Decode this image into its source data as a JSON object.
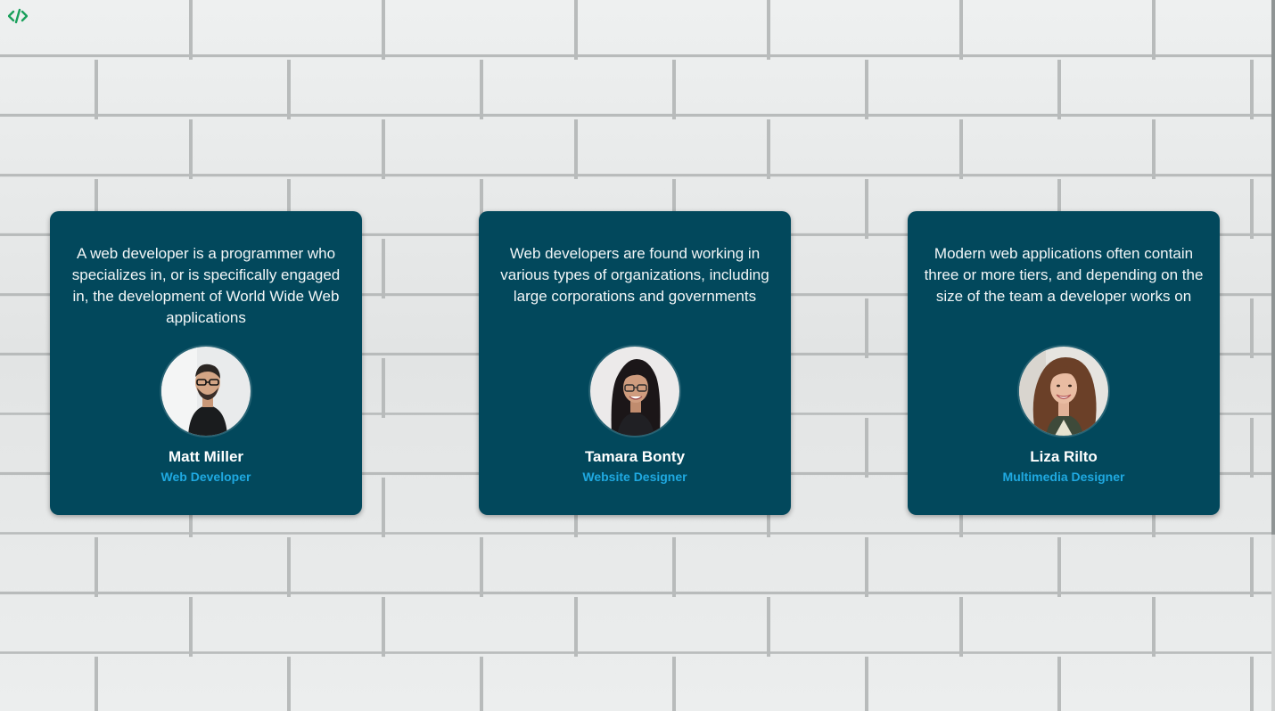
{
  "header": {
    "logo_icon": "code-brackets-icon",
    "logo_color": "#19a05b"
  },
  "colors": {
    "card_background": "#02485c",
    "role_text": "#1fa9e1",
    "name_text": "#ffffff"
  },
  "testimonials": [
    {
      "quote": "A web developer is a programmer who specializes in, or is specifically engaged in, the development of World Wide Web applications",
      "name": "Matt Miller",
      "role": "Web Developer",
      "avatar": "man-with-glasses-avatar"
    },
    {
      "quote": "Web developers are found working in various types of organizations, including large corporations and governments",
      "name": "Tamara Bonty",
      "role": "Website Designer",
      "avatar": "woman-with-glasses-avatar"
    },
    {
      "quote": "Modern web applications often contain three or more tiers, and depending on the size of the team a developer works on",
      "name": "Liza Rilto",
      "role": "Multimedia Designer",
      "avatar": "woman-curly-hair-avatar"
    }
  ]
}
